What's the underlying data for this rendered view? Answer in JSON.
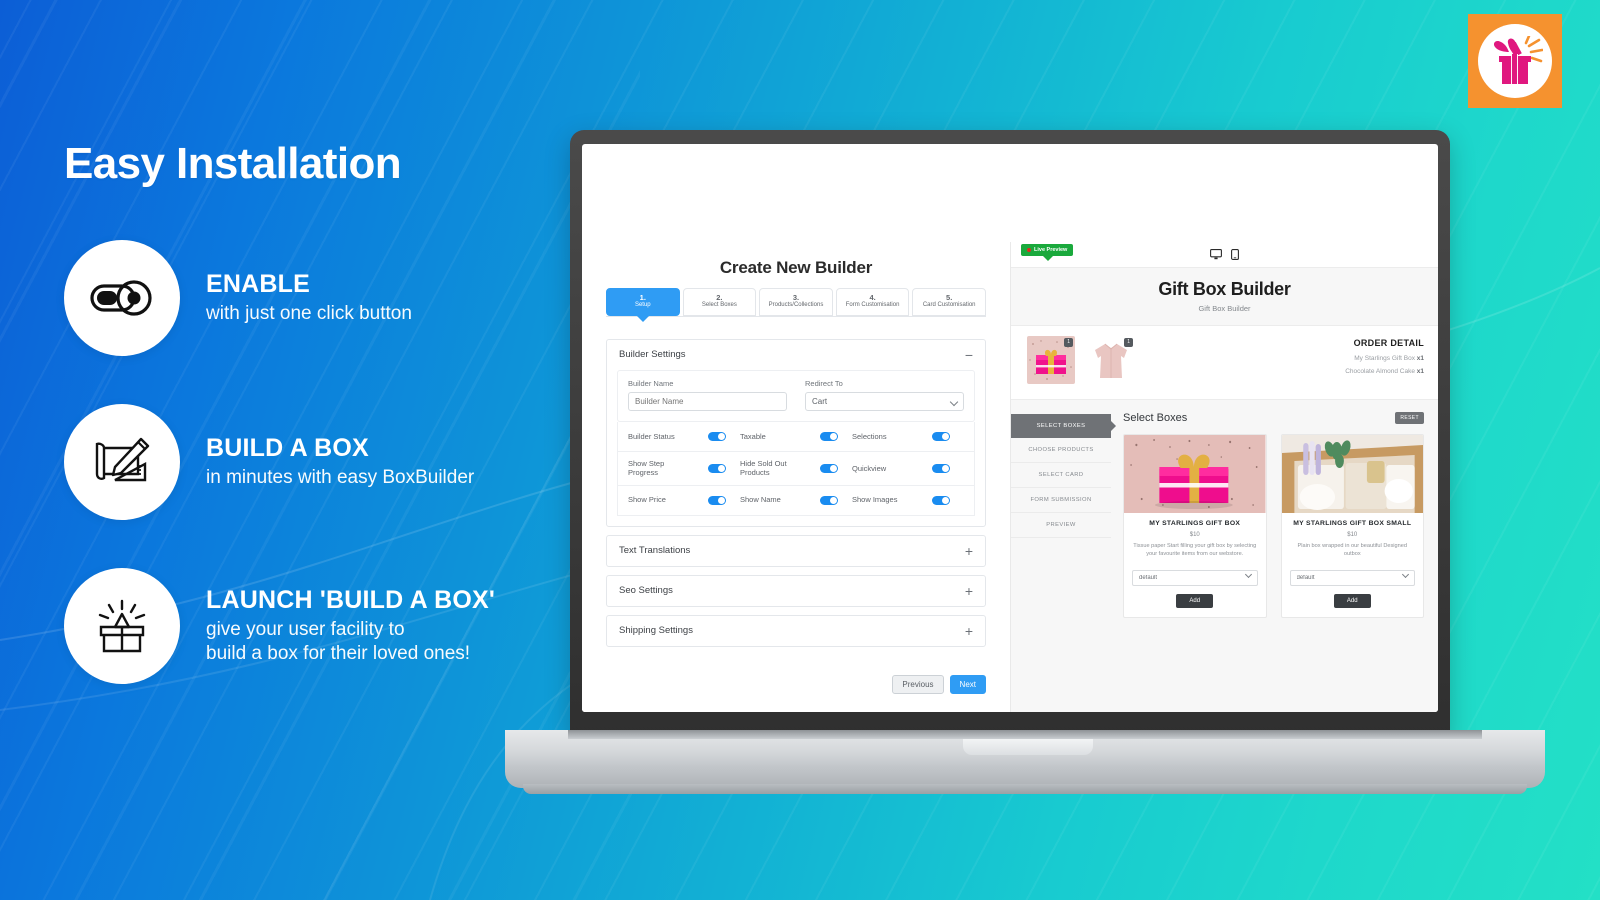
{
  "hero": {
    "headline": "Easy Installation",
    "features": [
      {
        "icon": "toggle-switch-icon",
        "title": "ENABLE",
        "subtitle": "with just one click button"
      },
      {
        "icon": "blueprint-pencil-icon",
        "title": "BUILD A BOX",
        "subtitle": "in minutes with easy BoxBuilder"
      },
      {
        "icon": "open-gift-box-icon",
        "title": "LAUNCH 'BUILD A BOX'",
        "subtitle_line1": "give your user facility to",
        "subtitle_line2": "build a box for their loved ones!"
      }
    ]
  },
  "brand_badge": {
    "icon": "gift-box-icon",
    "bg_color": "#f5922f",
    "accent_color": "#e0187f"
  },
  "builder": {
    "title": "Create New Builder",
    "steps": [
      {
        "num": "1.",
        "label": "Setup",
        "active": true
      },
      {
        "num": "2.",
        "label": "Select Boxes",
        "active": false
      },
      {
        "num": "3.",
        "label": "Products/Collections",
        "active": false
      },
      {
        "num": "4.",
        "label": "Form Customisation",
        "active": false
      },
      {
        "num": "5.",
        "label": "Card Customisation",
        "active": false
      }
    ],
    "settings_panel": {
      "heading": "Builder Settings",
      "sign": "−",
      "builder_name_label": "Builder Name",
      "builder_name_placeholder": "Builder Name",
      "redirect_label": "Redirect To",
      "redirect_value": "Cart",
      "toggles": [
        [
          "Builder Status",
          "Taxable",
          "Selections"
        ],
        [
          "Show Step Progress",
          "Hide Sold Out Products",
          "Quickview"
        ],
        [
          "Show Price",
          "Show Name",
          "Show Images"
        ]
      ]
    },
    "collapsed_panels": [
      {
        "heading": "Text Translations",
        "sign": "+"
      },
      {
        "heading": "Seo Settings",
        "sign": "+"
      },
      {
        "heading": "Shipping Settings",
        "sign": "+"
      }
    ],
    "actions": {
      "previous": "Previous",
      "next": "Next"
    }
  },
  "preview": {
    "live_badge": "Live Preview",
    "device_icons": [
      "desktop-icon",
      "mobile-icon"
    ],
    "title": "Gift Box Builder",
    "subtitle": "Gift Box Builder",
    "order_detail_heading": "ORDER DETAIL",
    "order_items": [
      {
        "name": "My Starlings Gift Box",
        "qty": "x1"
      },
      {
        "name": "Chocolate Almond Cake",
        "qty": "x1"
      }
    ],
    "thumbs": [
      {
        "name": "pink-gift-box-thumb",
        "qty": "1"
      },
      {
        "name": "pink-shirt-thumb",
        "qty": "1"
      }
    ],
    "sidebar": [
      {
        "label": "SELECT BOXES",
        "active": true
      },
      {
        "label": "CHOOSE PRODUCTS",
        "active": false
      },
      {
        "label": "SELECT CARD",
        "active": false
      },
      {
        "label": "FORM SUBMISSION",
        "active": false
      },
      {
        "label": "PREVIEW",
        "active": false
      }
    ],
    "section_title": "Select Boxes",
    "reset_label": "RESET",
    "products": [
      {
        "title": "MY STARLINGS GIFT BOX",
        "price": "$10",
        "description": "Tissue paper Start filling your gift box by selecting your favourite items from our webstore.",
        "variant": "default",
        "add_label": "Add"
      },
      {
        "title": "MY STARLINGS GIFT BOX SMALL",
        "price": "$10",
        "description": "Plain box wrapped in our beautiful Designed outbox",
        "variant": "default",
        "add_label": "Add"
      }
    ]
  },
  "colors": {
    "bg_blue": "#0c5ed6",
    "bg_teal": "#23e0c6",
    "accent_blue": "#2f9cf4",
    "badge_green": "#1aa93c",
    "dark_gray": "#6f7276"
  }
}
